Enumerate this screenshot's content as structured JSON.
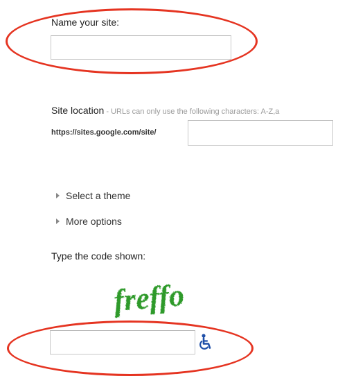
{
  "site_name": {
    "label": "Name your site:",
    "value": ""
  },
  "site_location": {
    "label": "Site location",
    "separator": " - ",
    "hint": "URLs can only use the following characters: A-Z,a",
    "url_prefix": "https://sites.google.com/site/",
    "value": ""
  },
  "expanders": {
    "theme": "Select a theme",
    "options": "More options"
  },
  "captcha": {
    "label": "Type the code shown:",
    "image_text": "freffo",
    "value": ""
  },
  "icons": {
    "expander": "triangle-right-icon",
    "accessibility": "wheelchair-icon"
  },
  "colors": {
    "annotation": "#e53421",
    "captcha_text": "#2f9a2a",
    "accessibility_icon": "#1f4fa8",
    "hint_text": "#999999"
  }
}
